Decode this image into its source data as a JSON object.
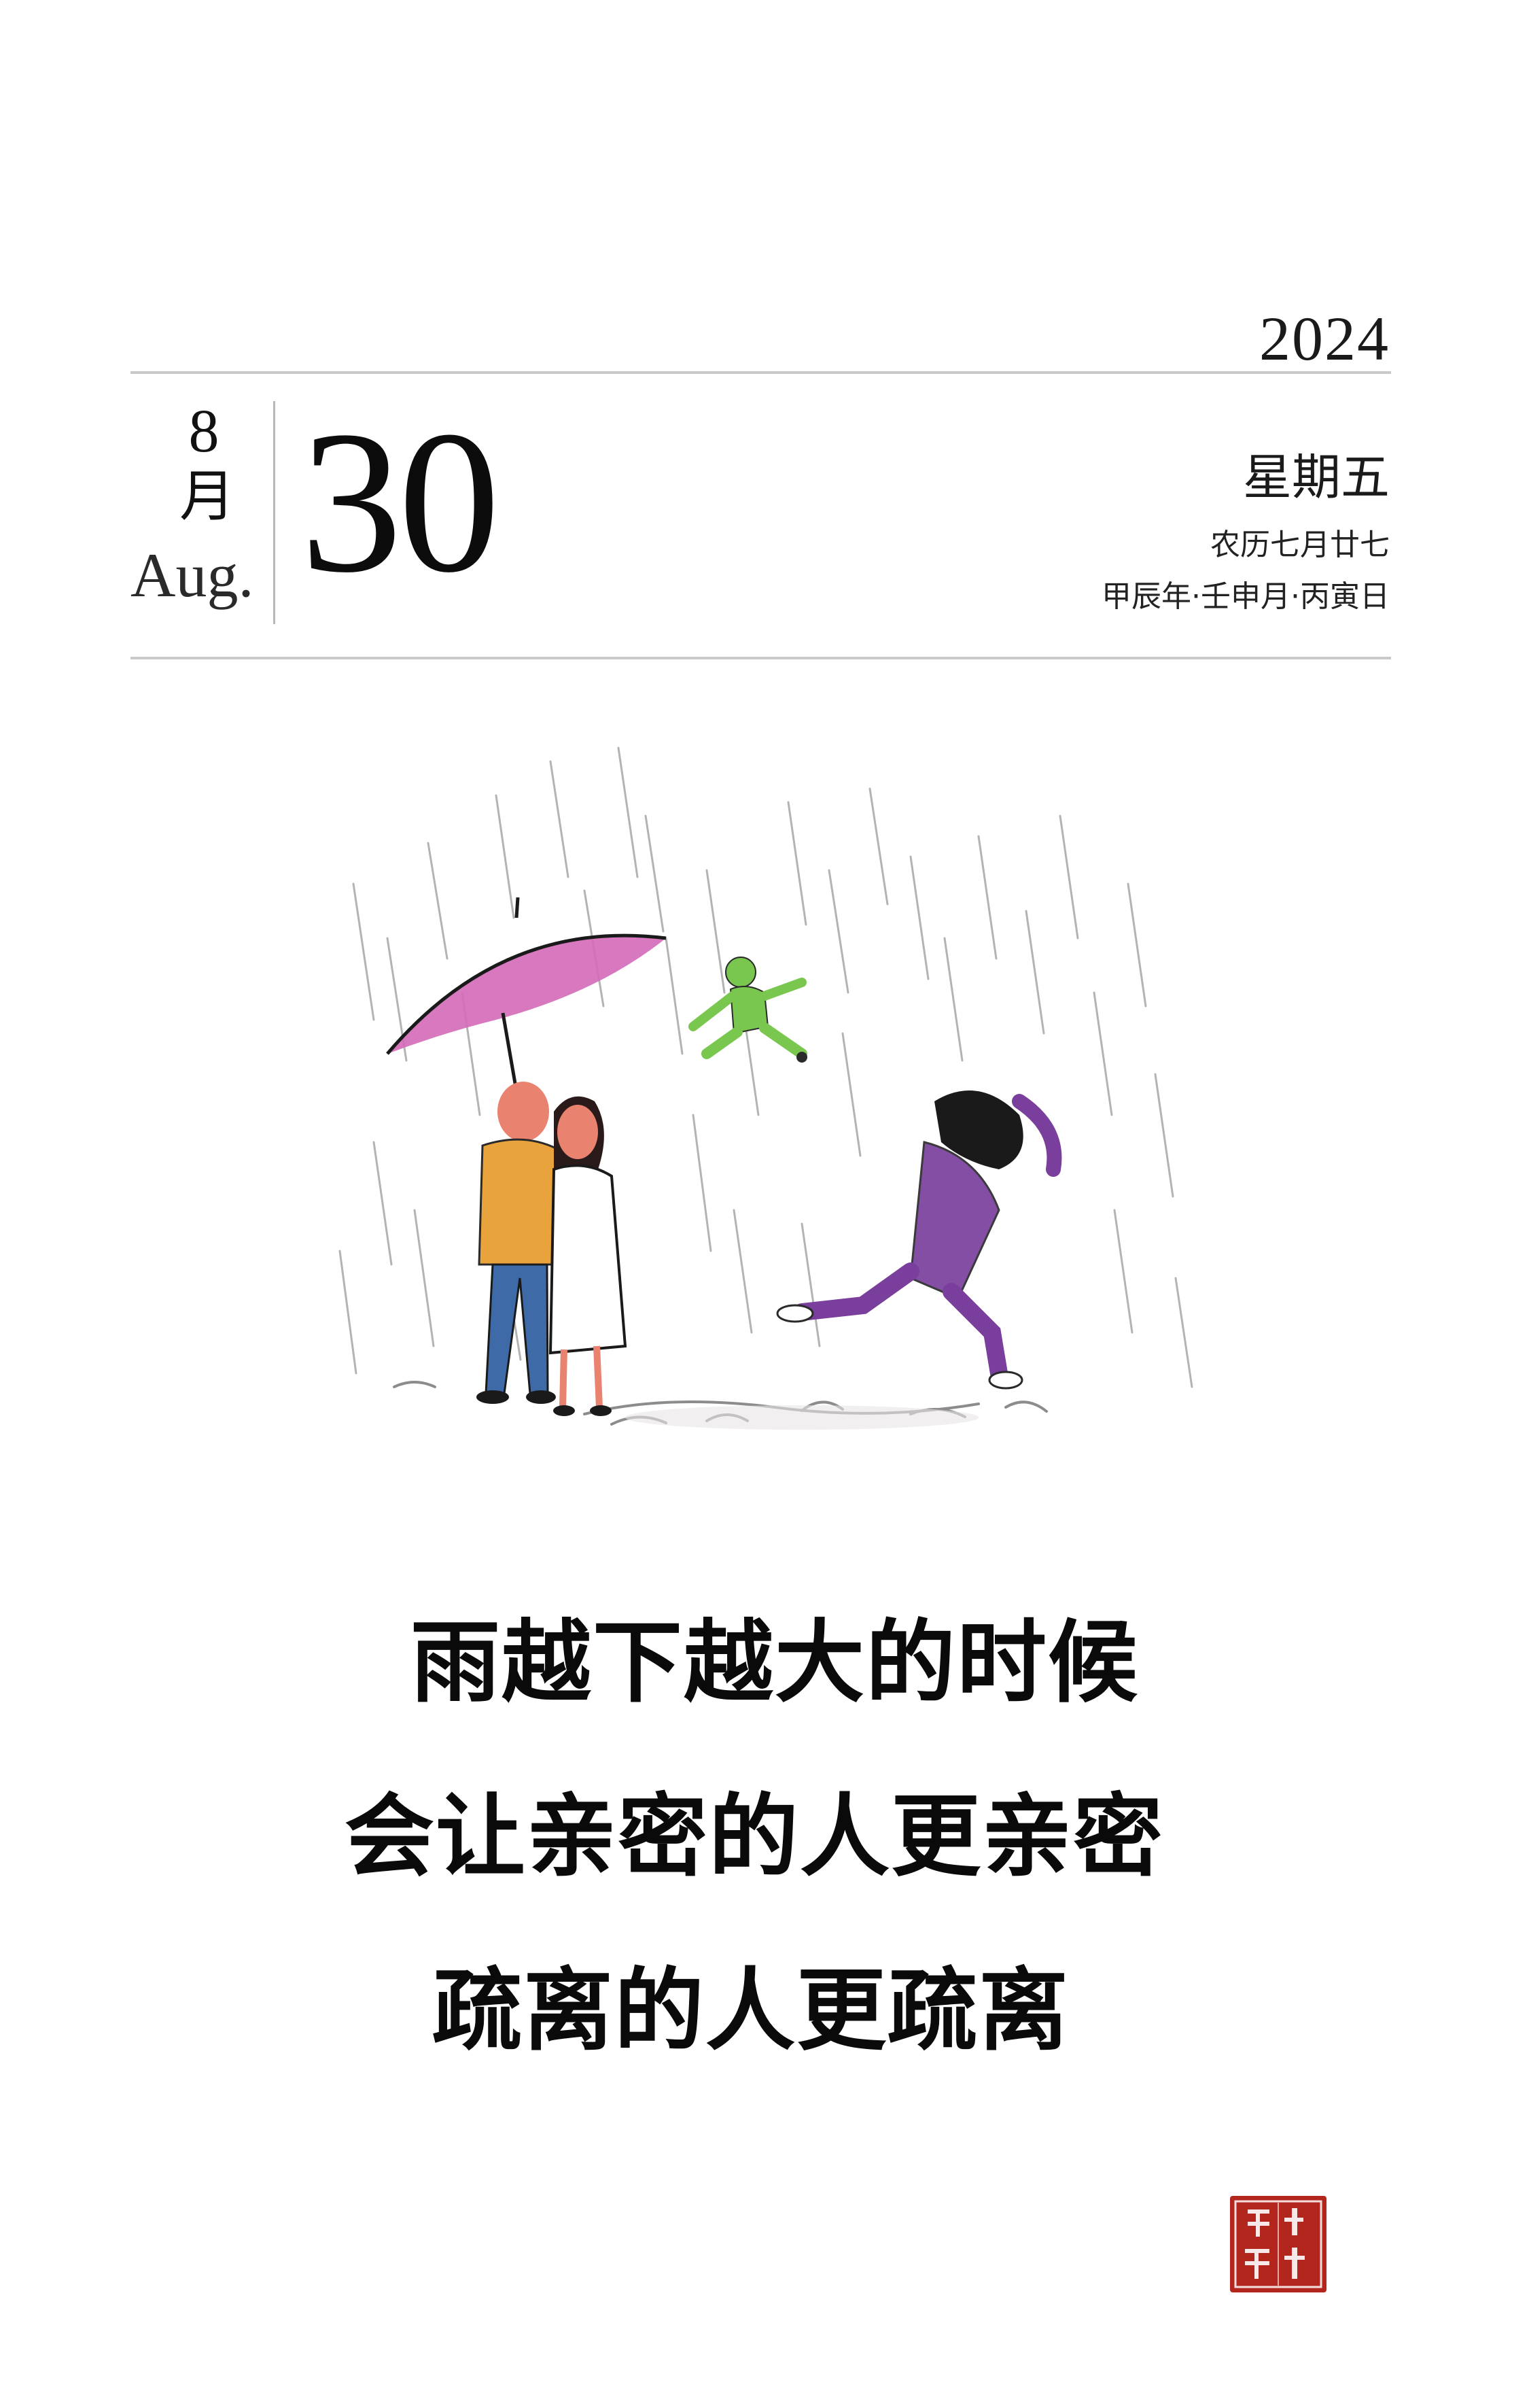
{
  "calendar": {
    "year": "2024",
    "month_number": "8",
    "month_cn": "月",
    "month_en": "Aug.",
    "day": "30",
    "weekday": "星期五",
    "lunar_date": "农历七月廿七",
    "ganzhi": "甲辰年·壬申月·丙寅日"
  },
  "quote": {
    "lines": [
      "雨越下越大的时候",
      "会让亲密的人更亲密",
      "疏离的人更疏离"
    ]
  },
  "seal": {
    "text": "小林漫画",
    "color": "#b3261e"
  },
  "colors": {
    "umbrella": "#d46ab9",
    "man_coat": "#e8a33d",
    "woman_dress": "#ffffff",
    "child_green": "#7ac74f",
    "runner_purple": "#7a3f9d",
    "skin": "#e9826e",
    "rule": "#c9c9c9"
  }
}
